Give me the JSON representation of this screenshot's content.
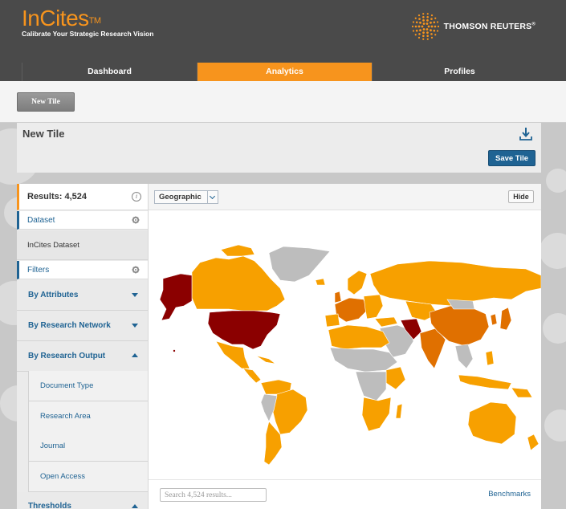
{
  "app": {
    "logo_text": "InCites",
    "trademark": "TM",
    "tagline": "Calibrate Your Strategic Research Vision",
    "brand": "THOMSON REUTERS",
    "brand_reg": "®"
  },
  "nav": {
    "tabs": [
      {
        "label": "Dashboard",
        "active": false
      },
      {
        "label": "Analytics",
        "active": true
      },
      {
        "label": "Profiles",
        "active": false
      }
    ]
  },
  "toolbar": {
    "new_tile_label": "New Tile"
  },
  "tile": {
    "title": "New Tile",
    "save_label": "Save Tile",
    "download_icon": "download-icon"
  },
  "sidebar": {
    "results_label": "Results: 4,524",
    "info_icon": "i",
    "dataset_label": "Dataset",
    "dataset_value": "InCites Dataset",
    "filters_label": "Filters",
    "accordions": [
      {
        "label": "By Attributes",
        "expanded": false
      },
      {
        "label": "By Research Network",
        "expanded": false
      },
      {
        "label": "By Research Output",
        "expanded": true
      }
    ],
    "sub_items": [
      "Document Type",
      "Research Area",
      "Journal",
      "Open Access"
    ],
    "thresholds_label": "Thresholds"
  },
  "main": {
    "view_select": "Geographic",
    "hide_label": "Hide",
    "search_placeholder": "Search 4,524 results...",
    "benchmarks_label": "Benchmarks"
  },
  "colors": {
    "accent": "#f7941d",
    "link": "#1f6393",
    "map_high": "#8b0000",
    "map_midhigh": "#e07000",
    "map_mid": "#f7a000",
    "map_none": "#bdbdbd"
  }
}
